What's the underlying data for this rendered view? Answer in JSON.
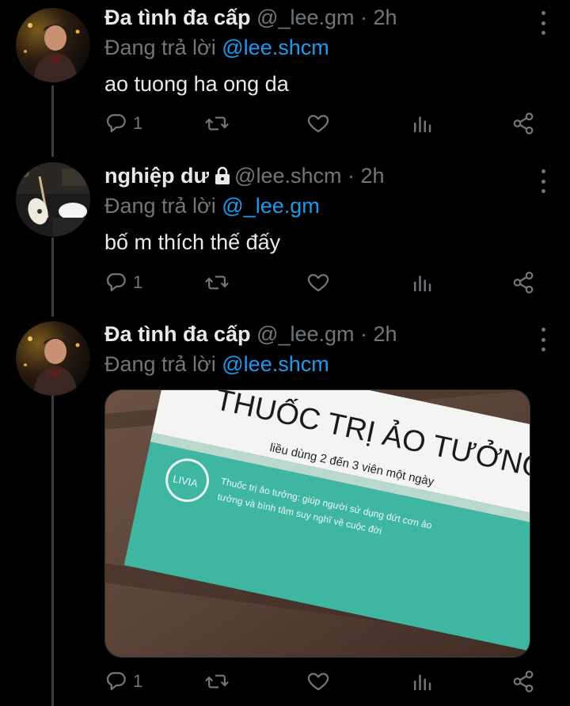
{
  "colors": {
    "background": "#000000",
    "text": "#e7e9ea",
    "muted": "#71767b",
    "link": "#1d9bf0"
  },
  "tweets": [
    {
      "name": "Đa tình đa cấp",
      "handle": "@_lee.gm",
      "sep": " · ",
      "time": "2h",
      "reply_prefix": "Đang trả lời ",
      "reply_to": "@lee.shcm",
      "text": "ao tuong ha ong da",
      "reply_count": "1",
      "icons": {
        "reply": "reply-icon",
        "retweet": "retweet-icon",
        "like": "heart-icon",
        "stats": "analytics-icon",
        "share": "share-icon",
        "more": "more-vertical-icon"
      }
    },
    {
      "name": "nghiệp dư",
      "locked": true,
      "handle": "@lee.shcm",
      "sep": " · ",
      "time": "2h",
      "reply_prefix": "Đang trả lời ",
      "reply_to": "@_lee.gm",
      "text": "bố m thích thế đấy",
      "reply_count": "1"
    },
    {
      "name": "Đa tình đa cấp",
      "handle": "@_lee.gm",
      "sep": " · ",
      "time": "2h",
      "reply_prefix": "Đang trả lời ",
      "reply_to": "@lee.shcm",
      "reply_count": "1",
      "media": {
        "box_title": "THUỐC TRỊ ẢO TƯỞNG",
        "box_dosage": "liều dùng 2 đến 3 viên một ngày",
        "brand": "LIVIA",
        "box_desc_1": "Thuốc trị ảo tưởng: giúp người sử dụng dứt cơn ảo",
        "box_desc_2": "tưởng và bình tâm suy nghĩ về cuộc đời"
      }
    }
  ]
}
